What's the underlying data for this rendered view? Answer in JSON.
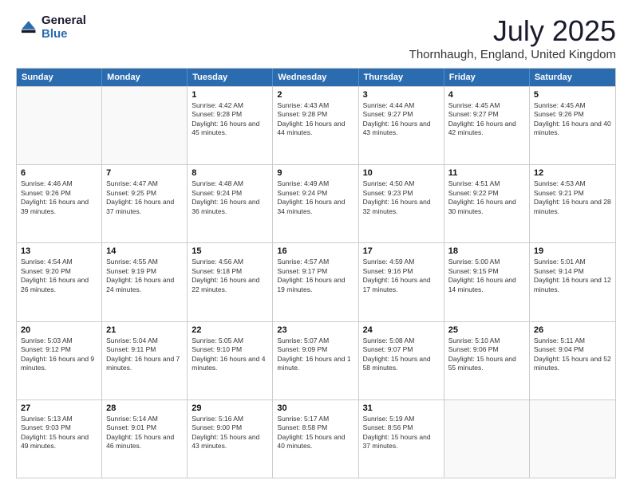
{
  "logo": {
    "general": "General",
    "blue": "Blue"
  },
  "title": "July 2025",
  "subtitle": "Thornhaugh, England, United Kingdom",
  "header_days": [
    "Sunday",
    "Monday",
    "Tuesday",
    "Wednesday",
    "Thursday",
    "Friday",
    "Saturday"
  ],
  "weeks": [
    [
      {
        "day": "",
        "sunrise": "",
        "sunset": "",
        "daylight": ""
      },
      {
        "day": "",
        "sunrise": "",
        "sunset": "",
        "daylight": ""
      },
      {
        "day": "1",
        "sunrise": "Sunrise: 4:42 AM",
        "sunset": "Sunset: 9:28 PM",
        "daylight": "Daylight: 16 hours and 45 minutes."
      },
      {
        "day": "2",
        "sunrise": "Sunrise: 4:43 AM",
        "sunset": "Sunset: 9:28 PM",
        "daylight": "Daylight: 16 hours and 44 minutes."
      },
      {
        "day": "3",
        "sunrise": "Sunrise: 4:44 AM",
        "sunset": "Sunset: 9:27 PM",
        "daylight": "Daylight: 16 hours and 43 minutes."
      },
      {
        "day": "4",
        "sunrise": "Sunrise: 4:45 AM",
        "sunset": "Sunset: 9:27 PM",
        "daylight": "Daylight: 16 hours and 42 minutes."
      },
      {
        "day": "5",
        "sunrise": "Sunrise: 4:45 AM",
        "sunset": "Sunset: 9:26 PM",
        "daylight": "Daylight: 16 hours and 40 minutes."
      }
    ],
    [
      {
        "day": "6",
        "sunrise": "Sunrise: 4:46 AM",
        "sunset": "Sunset: 9:26 PM",
        "daylight": "Daylight: 16 hours and 39 minutes."
      },
      {
        "day": "7",
        "sunrise": "Sunrise: 4:47 AM",
        "sunset": "Sunset: 9:25 PM",
        "daylight": "Daylight: 16 hours and 37 minutes."
      },
      {
        "day": "8",
        "sunrise": "Sunrise: 4:48 AM",
        "sunset": "Sunset: 9:24 PM",
        "daylight": "Daylight: 16 hours and 36 minutes."
      },
      {
        "day": "9",
        "sunrise": "Sunrise: 4:49 AM",
        "sunset": "Sunset: 9:24 PM",
        "daylight": "Daylight: 16 hours and 34 minutes."
      },
      {
        "day": "10",
        "sunrise": "Sunrise: 4:50 AM",
        "sunset": "Sunset: 9:23 PM",
        "daylight": "Daylight: 16 hours and 32 minutes."
      },
      {
        "day": "11",
        "sunrise": "Sunrise: 4:51 AM",
        "sunset": "Sunset: 9:22 PM",
        "daylight": "Daylight: 16 hours and 30 minutes."
      },
      {
        "day": "12",
        "sunrise": "Sunrise: 4:53 AM",
        "sunset": "Sunset: 9:21 PM",
        "daylight": "Daylight: 16 hours and 28 minutes."
      }
    ],
    [
      {
        "day": "13",
        "sunrise": "Sunrise: 4:54 AM",
        "sunset": "Sunset: 9:20 PM",
        "daylight": "Daylight: 16 hours and 26 minutes."
      },
      {
        "day": "14",
        "sunrise": "Sunrise: 4:55 AM",
        "sunset": "Sunset: 9:19 PM",
        "daylight": "Daylight: 16 hours and 24 minutes."
      },
      {
        "day": "15",
        "sunrise": "Sunrise: 4:56 AM",
        "sunset": "Sunset: 9:18 PM",
        "daylight": "Daylight: 16 hours and 22 minutes."
      },
      {
        "day": "16",
        "sunrise": "Sunrise: 4:57 AM",
        "sunset": "Sunset: 9:17 PM",
        "daylight": "Daylight: 16 hours and 19 minutes."
      },
      {
        "day": "17",
        "sunrise": "Sunrise: 4:59 AM",
        "sunset": "Sunset: 9:16 PM",
        "daylight": "Daylight: 16 hours and 17 minutes."
      },
      {
        "day": "18",
        "sunrise": "Sunrise: 5:00 AM",
        "sunset": "Sunset: 9:15 PM",
        "daylight": "Daylight: 16 hours and 14 minutes."
      },
      {
        "day": "19",
        "sunrise": "Sunrise: 5:01 AM",
        "sunset": "Sunset: 9:14 PM",
        "daylight": "Daylight: 16 hours and 12 minutes."
      }
    ],
    [
      {
        "day": "20",
        "sunrise": "Sunrise: 5:03 AM",
        "sunset": "Sunset: 9:12 PM",
        "daylight": "Daylight: 16 hours and 9 minutes."
      },
      {
        "day": "21",
        "sunrise": "Sunrise: 5:04 AM",
        "sunset": "Sunset: 9:11 PM",
        "daylight": "Daylight: 16 hours and 7 minutes."
      },
      {
        "day": "22",
        "sunrise": "Sunrise: 5:05 AM",
        "sunset": "Sunset: 9:10 PM",
        "daylight": "Daylight: 16 hours and 4 minutes."
      },
      {
        "day": "23",
        "sunrise": "Sunrise: 5:07 AM",
        "sunset": "Sunset: 9:09 PM",
        "daylight": "Daylight: 16 hours and 1 minute."
      },
      {
        "day": "24",
        "sunrise": "Sunrise: 5:08 AM",
        "sunset": "Sunset: 9:07 PM",
        "daylight": "Daylight: 15 hours and 58 minutes."
      },
      {
        "day": "25",
        "sunrise": "Sunrise: 5:10 AM",
        "sunset": "Sunset: 9:06 PM",
        "daylight": "Daylight: 15 hours and 55 minutes."
      },
      {
        "day": "26",
        "sunrise": "Sunrise: 5:11 AM",
        "sunset": "Sunset: 9:04 PM",
        "daylight": "Daylight: 15 hours and 52 minutes."
      }
    ],
    [
      {
        "day": "27",
        "sunrise": "Sunrise: 5:13 AM",
        "sunset": "Sunset: 9:03 PM",
        "daylight": "Daylight: 15 hours and 49 minutes."
      },
      {
        "day": "28",
        "sunrise": "Sunrise: 5:14 AM",
        "sunset": "Sunset: 9:01 PM",
        "daylight": "Daylight: 15 hours and 46 minutes."
      },
      {
        "day": "29",
        "sunrise": "Sunrise: 5:16 AM",
        "sunset": "Sunset: 9:00 PM",
        "daylight": "Daylight: 15 hours and 43 minutes."
      },
      {
        "day": "30",
        "sunrise": "Sunrise: 5:17 AM",
        "sunset": "Sunset: 8:58 PM",
        "daylight": "Daylight: 15 hours and 40 minutes."
      },
      {
        "day": "31",
        "sunrise": "Sunrise: 5:19 AM",
        "sunset": "Sunset: 8:56 PM",
        "daylight": "Daylight: 15 hours and 37 minutes."
      },
      {
        "day": "",
        "sunrise": "",
        "sunset": "",
        "daylight": ""
      },
      {
        "day": "",
        "sunrise": "",
        "sunset": "",
        "daylight": ""
      }
    ]
  ]
}
